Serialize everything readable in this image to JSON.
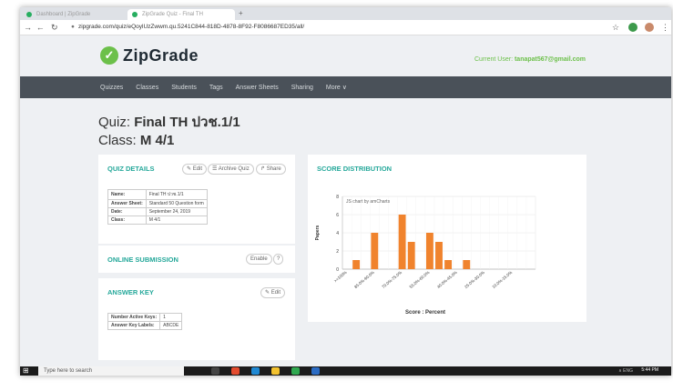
{
  "browser": {
    "tab1_title": "Dashboard | ZipGrade",
    "tab2_title": "ZipGrade Quiz - Final TH",
    "url": "zipgrade.com/quiz/eQoylUzZwwm.qu.5241C844-818D-4878-8F92-F8086687ED35/all/"
  },
  "header": {
    "logo_text": "ZipGrade",
    "current_user_label": "Current User:",
    "current_user_email": "tanapat567@gmail.com"
  },
  "nav": {
    "items": [
      "Quizzes",
      "Classes",
      "Students",
      "Tags",
      "Answer Sheets",
      "Sharing",
      "More ∨"
    ]
  },
  "quiz": {
    "label": "Quiz:",
    "name": "Final TH ปวช.1/1",
    "class_label": "Class:",
    "class_name": "M 4/1"
  },
  "details": {
    "title": "QUIZ DETAILS",
    "edit": "✎ Edit",
    "archive": "☰ Archive Quiz",
    "share": "↱ Share",
    "rows": [
      {
        "k": "Name:",
        "v": "Final TH ปวช.1/1"
      },
      {
        "k": "Answer Sheet:",
        "v": "Standard 50 Question form"
      },
      {
        "k": "Date:",
        "v": "September 24, 2019"
      },
      {
        "k": "Class:",
        "v": "M 4/1"
      }
    ]
  },
  "online": {
    "title": "ONLINE SUBMISSION",
    "enable": "Enable",
    "help": "?"
  },
  "answer_key": {
    "title": "ANSWER KEY",
    "edit": "✎ Edit",
    "rows": [
      {
        "k": "Number Active Keys:",
        "v": "1"
      },
      {
        "k": "Answer Key Labels:",
        "v": "ABCDE"
      }
    ]
  },
  "distribution": {
    "title": "SCORE DISTRIBUTION"
  },
  "chart_data": {
    "type": "bar",
    "title": "",
    "watermark": "JS chart by amCharts",
    "xlabel": "Score : Percent",
    "ylabel": "Papers",
    "ylim": [
      0,
      8
    ],
    "yticks": [
      0,
      2,
      4,
      6,
      8
    ],
    "categories": [
      ">=100%",
      "95.0%-100%",
      "90.0%-95.0%",
      "85.0%-90.0%",
      "80.0%-85.0%",
      "75.0%-80.0%",
      "70.0%-75.0%",
      "65.0%-70.0%",
      "60.0%-65.0%",
      "55.0%-60.0%",
      "50.0%-55.0%",
      "45.0%-50.0%",
      "40.0%-45.0%",
      "35.0%-40.0%",
      "30.0%-35.0%",
      "25.0%-30.0%",
      "20.0%-25.0%",
      "15.0%-20.0%",
      "10.0%-15.0%",
      "5.0%-10.0%",
      "0%-5.0%"
    ],
    "values": [
      0,
      1,
      0,
      4,
      0,
      0,
      6,
      3,
      0,
      4,
      3,
      1,
      0,
      1,
      0,
      0,
      0,
      0,
      0,
      0,
      0
    ],
    "tick_labels": [
      ">=100%",
      "85.0%-90.0%",
      "70.0%-75.0%",
      "55.0%-60.0%",
      "40.0%-45.0%",
      "25.0%-30.0%",
      "10.0%-15.0%"
    ],
    "tick_label_indices": [
      0,
      3,
      6,
      9,
      12,
      15,
      18
    ],
    "bar_color": "#f0832d",
    "grid": true
  },
  "taskbar": {
    "start": "⊞",
    "search_placeholder": "Type here to search",
    "time": "5:44 PM",
    "sys": "∧ ENG"
  }
}
